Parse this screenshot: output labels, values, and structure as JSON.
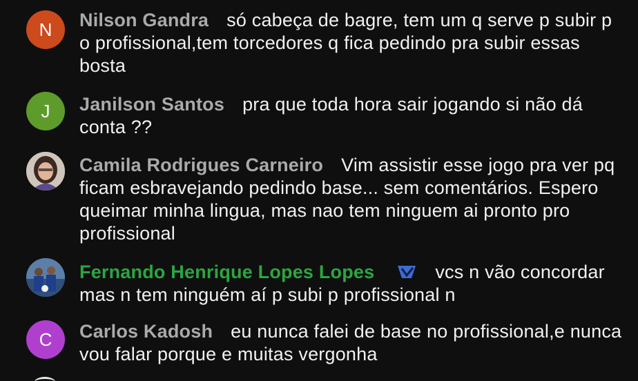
{
  "comments": [
    {
      "avatar_letter": "N",
      "avatar_color": "#cc4a1b",
      "author": "Nilson Gandra",
      "text": "só cabeça de bagre, tem um q serve p subir p o profissional,tem torcedores q fica pedindo pra subir essas bosta"
    },
    {
      "avatar_letter": "J",
      "avatar_color": "#5d9c2b",
      "author": "Janilson Santos",
      "text": "pra que toda hora sair jogando si não dá conta ??"
    },
    {
      "avatar_type": "photo",
      "author": "Camila Rodrigues Carneiro",
      "text": "Vim assistir esse jogo pra ver pq ficam esbravejando pedindo base... sem comentários. Espero queimar minha lingua, mas nao tem ninguem ai pronto pro profissional"
    },
    {
      "avatar_type": "photo",
      "author": "Fernando Henrique Lopes Lopes",
      "author_color": "#2ba640",
      "badge_icon": "member-badge-icon",
      "text": "vcs n vão concordar mas n tem ninguém aí p subi p profissional n"
    },
    {
      "avatar_letter": "C",
      "avatar_color": "#b03fd0",
      "author": "Carlos Kadosh",
      "text": "eu nunca falei de base no profissional,e nunca vou falar porque e muitas vergonha"
    }
  ]
}
